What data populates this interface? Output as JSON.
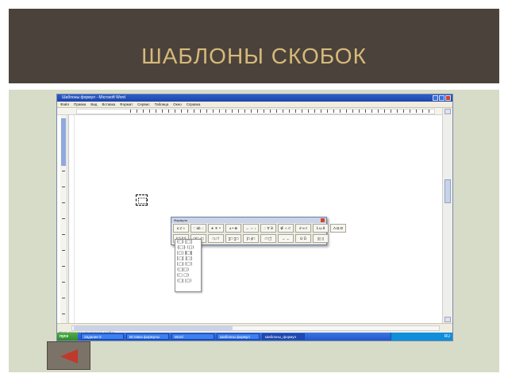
{
  "slide": {
    "title": "ШАБЛОНЫ СКОБОК",
    "header_bg": "#4b433b",
    "title_color": "#d7b97a",
    "body_bg": "#d7dcc9"
  },
  "screenshot": {
    "window_title": "Шаблоны формул - Microsoft Word",
    "menu": [
      "Файл",
      "Правка",
      "Вид",
      "Вставка",
      "Формат",
      "Сервис",
      "Таблица",
      "Окно",
      "Справка"
    ],
    "equation_toolbar": {
      "title": "Формула",
      "row1": [
        "≤ ≠ ≈",
        "∵ ab ∴",
        "∗ ∓ ∘",
        "± • ⊗",
        "→ ⇔ ↓",
        "∴ ∀ ∃",
        "∉ ∩ ⊂",
        "∂ ∞ ℓ",
        "λ ω θ",
        "Λ Ω Θ"
      ],
      "row2": [
        "(□) [□]",
        "□/□ √□",
        "□ᵢ □ⁱ",
        "∑□ ∑□",
        "∫□ ∮□",
        "□̄ □⃗",
        "→ ←",
        "Ū Ů",
        "▯▯ ▯"
      ]
    },
    "bracket_palette": [
      "(□) [□]",
      "{□} ⟨□⟩",
      "|□| ‖□‖",
      "[□[ ]□]",
      "⌊□⌋ ⌈□⌉",
      "⟨□|□⟩",
      "(□ □)",
      "⟨□| |□⟩"
    ],
    "status_text": "Открывающая квадратная скобка",
    "taskbar": {
      "start": "пуск",
      "tasks": [
        "Задание 5",
        "Вставка формулы",
        "Word",
        "Шаблоны формул",
        "Шаблоны_формул"
      ],
      "clock": "RU"
    }
  },
  "back_button": {
    "icon": "back-arrow-icon",
    "arrow_color": "#c0392b"
  }
}
